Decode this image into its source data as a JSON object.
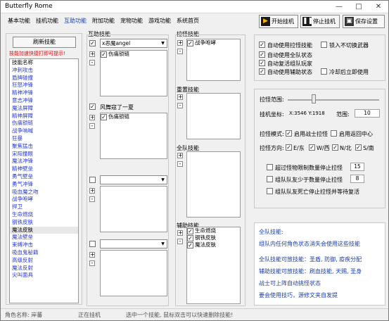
{
  "window": {
    "title": "Butterfly Rome",
    "minimize": "—",
    "maximize": "□",
    "close": "✕"
  },
  "menu": [
    "基本功能",
    "挂机功能",
    "互助功能",
    "附加功能",
    "宠物功能",
    "游戏功能",
    "系统首页"
  ],
  "toolbar": {
    "start": "开始挂机",
    "stop": "停止挂机",
    "save": "保存设置"
  },
  "left": {
    "button": "刷新技能",
    "warning": "技能加速快捷打即可提示!",
    "list_header": "技能名称",
    "skills": [
      "冲刺攻击",
      "盾牌碰撞",
      "狂怒冲锋",
      "精神冲锋",
      "意志冲锋",
      "魔法屏障",
      "精神屏障",
      "伤痛锁链",
      "战争呐喊",
      "狂暴",
      "聚焦猛击",
      "宋阳撞眼",
      "魔法冲锋",
      "精神壁垒",
      "勇气壁垒",
      "勇气冲锋",
      "吸血魔之吻",
      "战争咆哮",
      "捍卫",
      "生命燃烧",
      "钢铁皮肤",
      "魔法皮肤",
      "魔法壁垒",
      "束缚冲击",
      "吸血鬼秘籍",
      "高级反射",
      "魔法反射",
      "尖叫面具"
    ],
    "selected_index": 21
  },
  "col2": {
    "title": "互助技能",
    "g1": {
      "dropdown": "x恶魔angel",
      "entry": "伤痛锁链"
    },
    "g2": {
      "dropdown": "风舞寇了一夏",
      "entry": "伤痛锁链"
    },
    "g3": {
      "dropdown": ""
    },
    "g4": {
      "dropdown": ""
    }
  },
  "col3": {
    "t1": "拉怪技能",
    "t1_entry": "战争咆哮",
    "t2": "重置技能",
    "t3": "全队技能",
    "t4": "辅助技能",
    "t4_entries": [
      "生命燃烧",
      "钢铁皮肤",
      "魔法皮肤"
    ]
  },
  "right": {
    "opts": [
      "自动使用拉怪技能",
      "自动使用全队状态",
      "自动复活组队玩家",
      "自动使用辅助状态"
    ],
    "opt_lock": "锁入不切换武器",
    "opt_cd": "冷却后立即使用",
    "range_label": "拉怪范围:",
    "coord_label": "挂机坐标:",
    "coord_val": "X:3546 Y:1918",
    "radius_label": "范围:",
    "radius_val": "10",
    "mode_label": "拉怪模式:",
    "mode_warrior": "启用战士拉怪",
    "mode_return": "启用返回中心",
    "dir_label": "拉怪方向:",
    "dirs": [
      "E/东",
      "W/西",
      "N/北",
      "S/南"
    ],
    "rule1": "超过怪物限制数量停止拉怪",
    "rule1_val": "15",
    "rule2": "组队队友少于数量停止拉怪",
    "rule2_val": "8",
    "rule3": "组队队友死亡停止拉怪并等待复活",
    "notes": [
      "全队技能:",
      "组队内任何角色状态消失会使用这些技能",
      "全队技能可放技能：圣盾, 防御, 疫疾分配",
      "辅助技能可放技能：刷血技能, 天赐, 圣身",
      "战士可上阵自动挑怪状态",
      "要会使用技巧，源修文夹自发提"
    ]
  },
  "status": {
    "role": "角色名称: 岸蕃",
    "state": "正在挂机",
    "hint": "选中一个技能, 鼠标双击可以快速删除技能!"
  },
  "colors": {
    "accent": "#1a3fb0",
    "warning": "#d01010",
    "skill_text": "#2a3bd0"
  }
}
